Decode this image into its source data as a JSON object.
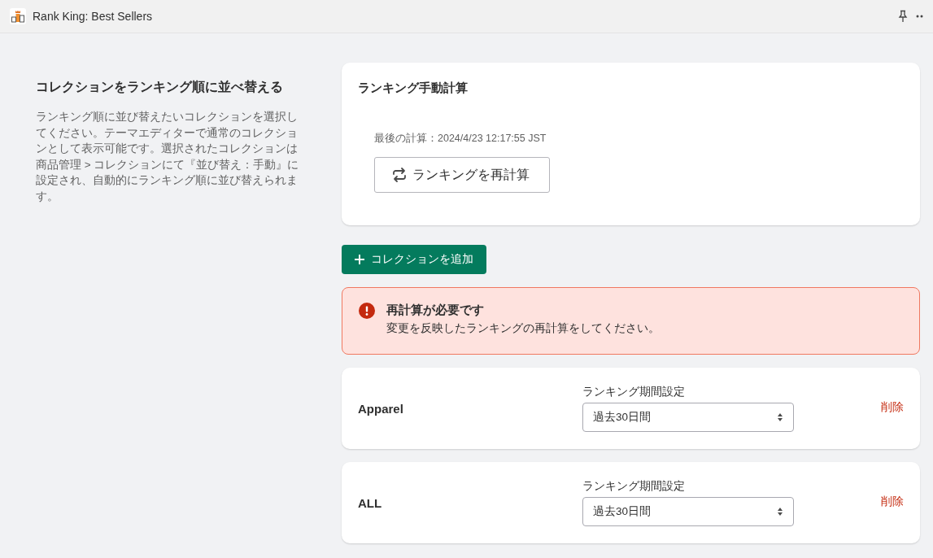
{
  "app_bar": {
    "title": "Rank King: Best Sellers"
  },
  "intro": {
    "heading": "コレクションをランキング順に並べ替える",
    "description": "ランキング順に並び替えたいコレクションを選択してください。テーマエディターで通常のコレクションとして表示可能です。選択されたコレクションは商品管理 > コレクションにて『並び替え：手動』に設定され、自動的にランキング順に並び替えられます。"
  },
  "manual_calc": {
    "title": "ランキング手動計算",
    "last_calculated": "最後の計算：2024/4/23 12:17:55 JST",
    "button": "ランキングを再計算"
  },
  "add_button": "コレクションを追加",
  "alert": {
    "kind": "critical",
    "title": "再計算が必要です",
    "message": "変更を反映したランキングの再計算をしてください。"
  },
  "collections": [
    {
      "name": "Apparel",
      "period_label": "ランキング期間設定",
      "period": "過去30日間",
      "delete": "削除"
    },
    {
      "name": "ALL",
      "period_label": "ランキング期間設定",
      "period": "過去30日間",
      "delete": "削除"
    }
  ]
}
